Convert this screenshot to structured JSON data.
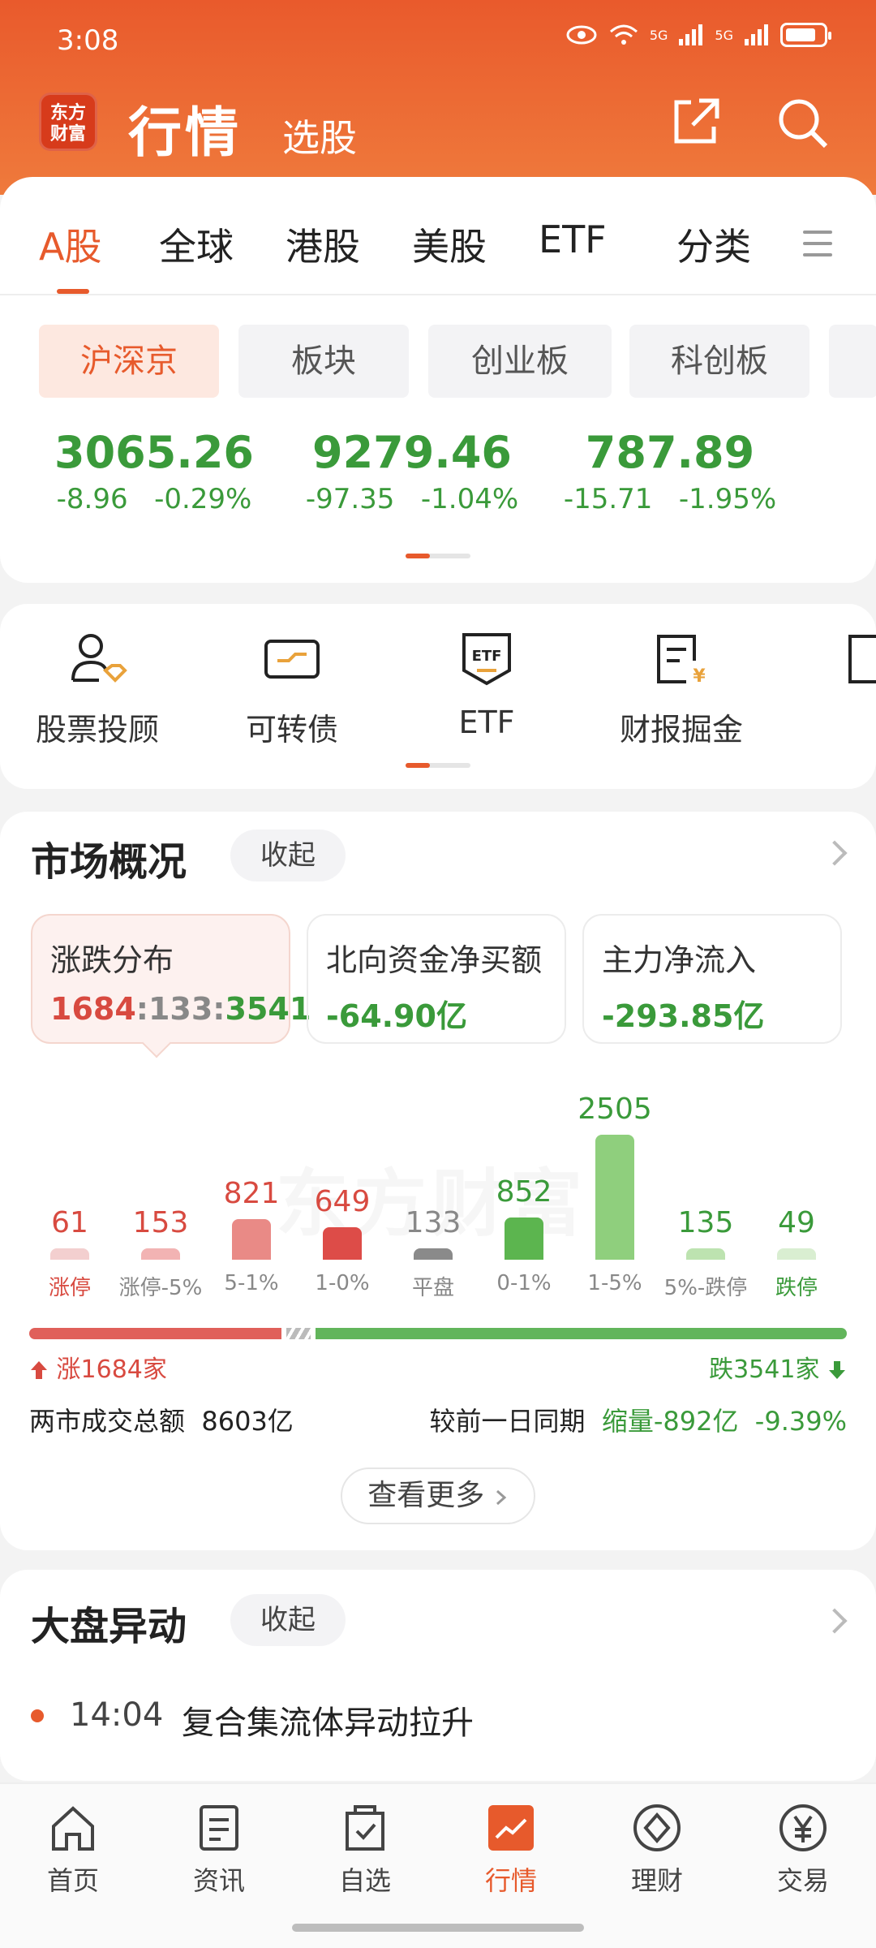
{
  "status_bar": {
    "time": "3:08",
    "net1": "5G",
    "net2": "5G"
  },
  "header": {
    "logo_line1": "东方",
    "logo_line2": "财富",
    "title": "行情",
    "subtitle": "选股"
  },
  "tabs": [
    "A股",
    "全球",
    "港股",
    "美股",
    "ETF",
    "分类"
  ],
  "market_chips": [
    "沪深京",
    "板块",
    "创业板",
    "科创板"
  ],
  "indices": [
    {
      "value": "3065.26",
      "change": "-8.96",
      "pct": "-0.29%"
    },
    {
      "value": "9279.46",
      "change": "-97.35",
      "pct": "-1.04%"
    },
    {
      "value": "787.89",
      "change": "-15.71",
      "pct": "-1.95%"
    }
  ],
  "features": [
    "股票投顾",
    "可转债",
    "ETF",
    "财报掘金"
  ],
  "market_overview": {
    "title": "市场概况",
    "collapse_label": "收起",
    "stats": [
      {
        "label": "涨跌分布",
        "up": "1684",
        "flat": "133",
        "down": "3541",
        "sep": ":"
      },
      {
        "label": "北向资金净买额",
        "value": "-64.90亿"
      },
      {
        "label": "主力净流入",
        "value": "-293.85亿"
      }
    ],
    "watermark": "东方财富",
    "distribution": [
      {
        "count": "61",
        "label": "涨停",
        "value": 61,
        "color": "#f3cfcf",
        "text_color": "#d84a40",
        "label_color": "#d84a40"
      },
      {
        "count": "153",
        "label": "涨停-5%",
        "value": 153,
        "color": "#f2b3b3",
        "text_color": "#d84a40",
        "label_color": "#888888"
      },
      {
        "count": "821",
        "label": "5-1%",
        "value": 821,
        "color": "#e98a86",
        "text_color": "#d84a40",
        "label_color": "#888888"
      },
      {
        "count": "649",
        "label": "1-0%",
        "value": 649,
        "color": "#dd4c48",
        "text_color": "#d84a40",
        "label_color": "#888888"
      },
      {
        "count": "133",
        "label": "平盘",
        "value": 133,
        "color": "#8a8a8a",
        "text_color": "#888888",
        "label_color": "#888888"
      },
      {
        "count": "852",
        "label": "0-1%",
        "value": 852,
        "color": "#5cb54f",
        "text_color": "#3a9a3a",
        "label_color": "#888888"
      },
      {
        "count": "2505",
        "label": "1-5%",
        "value": 2505,
        "color": "#8fcf7d",
        "text_color": "#3a9a3a",
        "label_color": "#888888"
      },
      {
        "count": "135",
        "label": "5%-跌停",
        "value": 135,
        "color": "#bde3b0",
        "text_color": "#3a9a3a",
        "label_color": "#888888"
      },
      {
        "count": "49",
        "label": "跌停",
        "value": 49,
        "color": "#d9eed1",
        "text_color": "#3a9a3a",
        "label_color": "#3a9a3a"
      }
    ],
    "up_count_label": "涨1684家",
    "down_count_label": "跌3541家",
    "up_total": 1684,
    "flat_total": 133,
    "down_total": 3541,
    "turnover_label": "两市成交总额",
    "turnover_value": "8603亿",
    "compare_label": "较前一日同期",
    "compare_value": "缩量-892亿",
    "compare_pct": "-9.39%",
    "more_label": "查看更多"
  },
  "movers": {
    "title": "大盘异动",
    "collapse_label": "收起",
    "items": [
      {
        "time": "14:04",
        "text": "复合集流体异动拉升"
      }
    ]
  },
  "bottom_nav": [
    "首页",
    "资讯",
    "自选",
    "行情",
    "理财",
    "交易"
  ],
  "colors": {
    "brand": "#e75a2c",
    "up": "#d84a40",
    "down": "#3a9a3a"
  }
}
